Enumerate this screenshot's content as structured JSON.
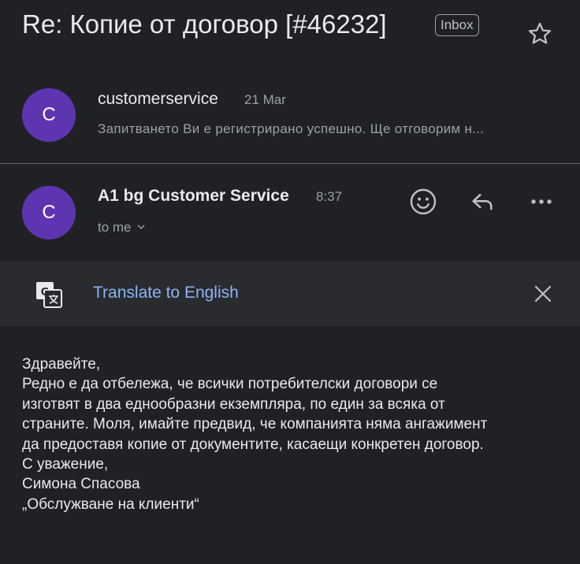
{
  "thread": {
    "subject": "Re: Копие от договор [#46232]",
    "label": "Inbox"
  },
  "messages": [
    {
      "avatar_letter": "C",
      "sender": "customerservice",
      "date": "21 Mar",
      "snippet": "Запитването Ви е регистрирано успешно. Ще отговорим н..."
    },
    {
      "avatar_letter": "C",
      "sender": "A1 bg Customer Service",
      "time": "8:37",
      "recipient": "to me"
    }
  ],
  "translate_bar": {
    "link_label": "Translate to English"
  },
  "body_lines": [
    "Здравейте,",
    "Редно е да отбележа, че всички потребителски договори се",
    "изготвят в два еднообразни екземпляра, по един за всяка от",
    "страните. Моля, имайте предвид, че компанията няма ангажимент",
    "да предоставя копие от документите, касаещи конкретен договор.",
    "С уважение,",
    "Симона Спасова",
    "„Обслужване на клиенти“"
  ],
  "colors": {
    "background": "#202124",
    "avatar": "#5e35b1",
    "link": "#8ab4f8",
    "secondary_text": "#9aa0a6"
  },
  "icons": [
    "star-icon",
    "emoji-icon",
    "reply-icon",
    "more-icon",
    "chevron-down-icon",
    "google-translate-icon",
    "close-icon"
  ]
}
